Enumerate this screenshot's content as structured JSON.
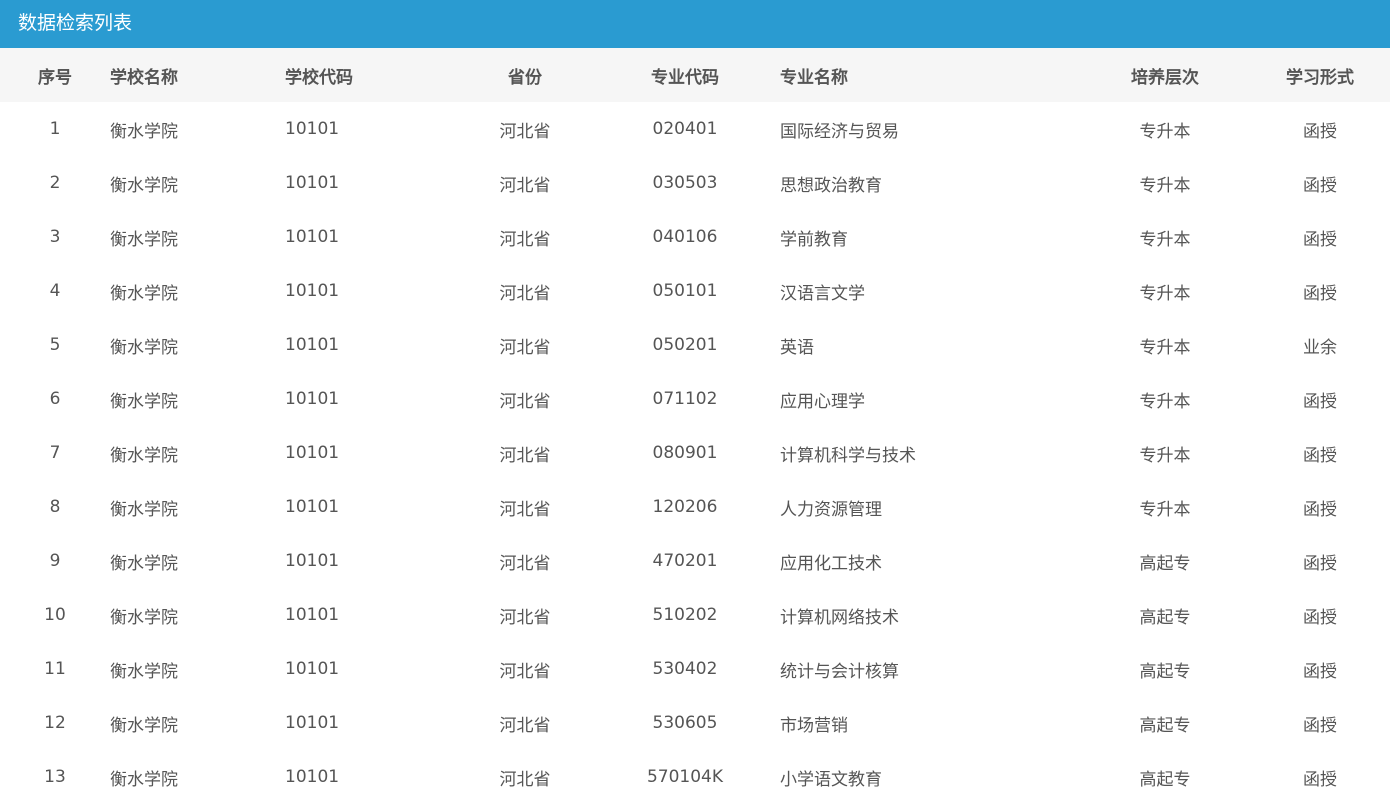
{
  "title": "数据检索列表",
  "columns": [
    "序号",
    "学校名称",
    "学校代码",
    "省份",
    "专业代码",
    "专业名称",
    "培养层次",
    "学习形式"
  ],
  "rows": [
    [
      "1",
      "衡水学院",
      "10101",
      "河北省",
      "020401",
      "国际经济与贸易",
      "专升本",
      "函授"
    ],
    [
      "2",
      "衡水学院",
      "10101",
      "河北省",
      "030503",
      "思想政治教育",
      "专升本",
      "函授"
    ],
    [
      "3",
      "衡水学院",
      "10101",
      "河北省",
      "040106",
      "学前教育",
      "专升本",
      "函授"
    ],
    [
      "4",
      "衡水学院",
      "10101",
      "河北省",
      "050101",
      "汉语言文学",
      "专升本",
      "函授"
    ],
    [
      "5",
      "衡水学院",
      "10101",
      "河北省",
      "050201",
      "英语",
      "专升本",
      "业余"
    ],
    [
      "6",
      "衡水学院",
      "10101",
      "河北省",
      "071102",
      "应用心理学",
      "专升本",
      "函授"
    ],
    [
      "7",
      "衡水学院",
      "10101",
      "河北省",
      "080901",
      "计算机科学与技术",
      "专升本",
      "函授"
    ],
    [
      "8",
      "衡水学院",
      "10101",
      "河北省",
      "120206",
      "人力资源管理",
      "专升本",
      "函授"
    ],
    [
      "9",
      "衡水学院",
      "10101",
      "河北省",
      "470201",
      "应用化工技术",
      "高起专",
      "函授"
    ],
    [
      "10",
      "衡水学院",
      "10101",
      "河北省",
      "510202",
      "计算机网络技术",
      "高起专",
      "函授"
    ],
    [
      "11",
      "衡水学院",
      "10101",
      "河北省",
      "530402",
      "统计与会计核算",
      "高起专",
      "函授"
    ],
    [
      "12",
      "衡水学院",
      "10101",
      "河北省",
      "530605",
      "市场营销",
      "高起专",
      "函授"
    ],
    [
      "13",
      "衡水学院",
      "10101",
      "河北省",
      "570104K",
      "小学语文教育",
      "高起专",
      "函授"
    ]
  ]
}
